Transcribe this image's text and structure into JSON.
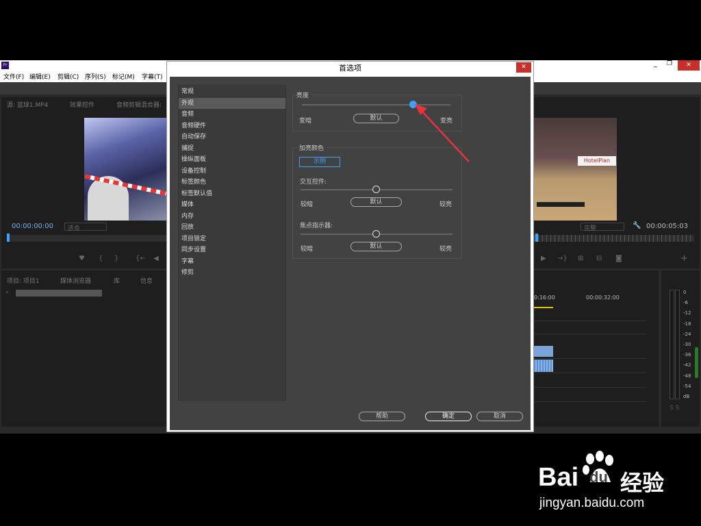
{
  "app": {
    "menu": [
      "文件(F)",
      "编辑(E)",
      "剪辑(C)",
      "序列(S)",
      "标记(M)",
      "字幕(T)"
    ],
    "source_tabs": [
      "源: 篮球1.MP4",
      "效果控件",
      "音频剪辑混合器: "
    ],
    "source_timecode": "00:00:00:00",
    "source_fit": "适合",
    "program_timecode": "00:00:05:03",
    "program_fit": "完整",
    "project_tabs": [
      "项目: 项目1",
      "媒体浏览器",
      "库",
      "信息"
    ],
    "timeline_ruler": [
      "0:16:00",
      "00:00:32:00"
    ],
    "meter_scale": [
      "0",
      "-6",
      "-12",
      "-18",
      "-24",
      "-30",
      "-36",
      "-42",
      "-48",
      "-54",
      "dB"
    ],
    "meter_footer": "S S",
    "colors": {
      "accent": "#3ea0ff",
      "arrow": "#e8333a"
    }
  },
  "dialog": {
    "title": "首选项",
    "close": "✕",
    "categories": [
      "常规",
      "外观",
      "音频",
      "音频硬件",
      "自动保存",
      "捕捉",
      "操纵面板",
      "设备控制",
      "标签颜色",
      "标签默认值",
      "媒体",
      "内存",
      "回放",
      "项目锁定",
      "同步设置",
      "字幕",
      "修剪"
    ],
    "selected_category": "外观",
    "brightness": {
      "label": "亮度",
      "darker": "变暗",
      "lighter": "变亮",
      "default": "默认"
    },
    "highlight": {
      "label": "加亮颜色",
      "sample": "示例",
      "interactive": {
        "label": "交互控件:",
        "darker": "较暗",
        "lighter": "较亮",
        "default": "默认"
      },
      "focus": {
        "label": "焦点指示器:",
        "darker": "较暗",
        "lighter": "较亮",
        "default": "默认"
      }
    },
    "buttons": {
      "help": "帮助",
      "ok": "确定",
      "cancel": "取消"
    }
  },
  "watermark": {
    "brand": "Bai",
    "brand2": "du",
    "cn": "经验",
    "url": "jingyan.baidu.com"
  }
}
